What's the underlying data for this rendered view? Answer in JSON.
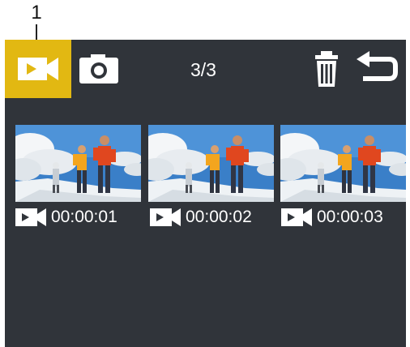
{
  "callout": {
    "number": "1"
  },
  "topbar": {
    "modes": [
      {
        "icon": "video-camera-icon",
        "active": true
      },
      {
        "icon": "photo-camera-icon",
        "active": false
      }
    ],
    "counter": "3/3",
    "actions": [
      {
        "icon": "trash-icon"
      },
      {
        "icon": "back-arrow-icon"
      }
    ]
  },
  "thumbnails": [
    {
      "type_icon": "video-camera-icon",
      "duration": "00:00:01"
    },
    {
      "type_icon": "video-camera-icon",
      "duration": "00:00:02"
    },
    {
      "type_icon": "video-camera-icon",
      "duration": "00:00:03"
    }
  ],
  "colors": {
    "screen_background": "#30343a",
    "active_tab": "#e2b812",
    "text": "#ffffff"
  }
}
